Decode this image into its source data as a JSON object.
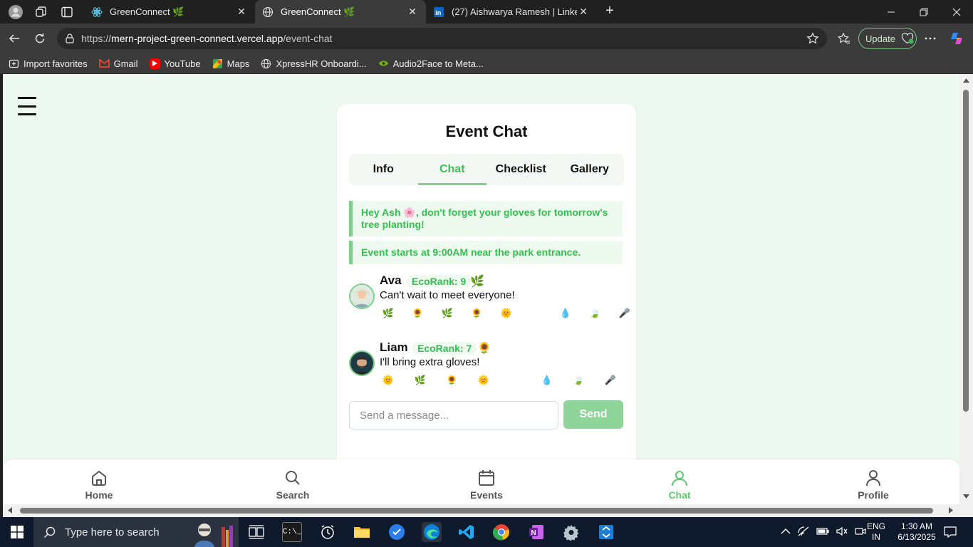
{
  "browser": {
    "tabs": [
      {
        "title": "GreenConnect 🌿",
        "active": false
      },
      {
        "title": "GreenConnect 🌿",
        "active": true
      },
      {
        "title": "(27) Aishwarya Ramesh | LinkedIn",
        "active": false
      }
    ],
    "url_prefix": "https://",
    "url_host": "mern-project-green-connect.vercel.app",
    "url_path": "/event-chat",
    "update_label": "Update",
    "bookmarks": [
      {
        "label": "Import favorites",
        "icon": "import-icon"
      },
      {
        "label": "Gmail",
        "icon": "gmail-icon",
        "color": "#ea4335"
      },
      {
        "label": "YouTube",
        "icon": "youtube-icon",
        "color": "#ff0000"
      },
      {
        "label": "Maps",
        "icon": "maps-icon",
        "color": "#34a853"
      },
      {
        "label": "XpressHR Onboardi...",
        "icon": "globe-icon"
      },
      {
        "label": "Audio2Face to Meta...",
        "icon": "nvidia-icon",
        "color": "#76b900"
      }
    ]
  },
  "page": {
    "title": "Event Chat",
    "tabs": [
      {
        "label": "Info",
        "active": false
      },
      {
        "label": "Chat",
        "active": true
      },
      {
        "label": "Checklist",
        "active": false
      },
      {
        "label": "Gallery",
        "active": false
      }
    ],
    "notices": [
      "Hey Ash 🌸, don't forget your gloves for tomorrow's tree planting!",
      "Event starts at 9:00AM near the park entrance."
    ],
    "messages": [
      {
        "name": "Ava",
        "rank": "EcoRank: 9",
        "rank_emoji": "🌿",
        "text": "Can't wait to meet everyone!",
        "reactions": [
          "🌿",
          "🌻",
          "🌿",
          "🌻",
          "🌞",
          "🌧",
          "💧",
          "🍃",
          "🎤"
        ]
      },
      {
        "name": "Liam",
        "rank": "EcoRank: 7",
        "rank_emoji": "🌻",
        "text": "I'll bring extra gloves!",
        "reactions": [
          "🌞",
          "🌿",
          "🌻",
          "🌞",
          "🌧",
          "💧",
          "🍃",
          "🎤"
        ]
      }
    ],
    "input_placeholder": "Send a message...",
    "send_label": "Send",
    "accent": "#3fbf55"
  },
  "bottom_nav": [
    {
      "label": "Home",
      "icon": "home-icon",
      "active": false
    },
    {
      "label": "Search",
      "icon": "search-icon",
      "active": false
    },
    {
      "label": "Events",
      "icon": "calendar-icon",
      "active": false
    },
    {
      "label": "Chat",
      "icon": "user-icon",
      "active": true
    },
    {
      "label": "Profile",
      "icon": "profile-icon",
      "active": false
    }
  ],
  "taskbar": {
    "search_placeholder": "Type here to search",
    "lang_top": "ENG",
    "lang_bottom": "IN",
    "time": "1:30 AM",
    "date": "6/13/2025"
  }
}
